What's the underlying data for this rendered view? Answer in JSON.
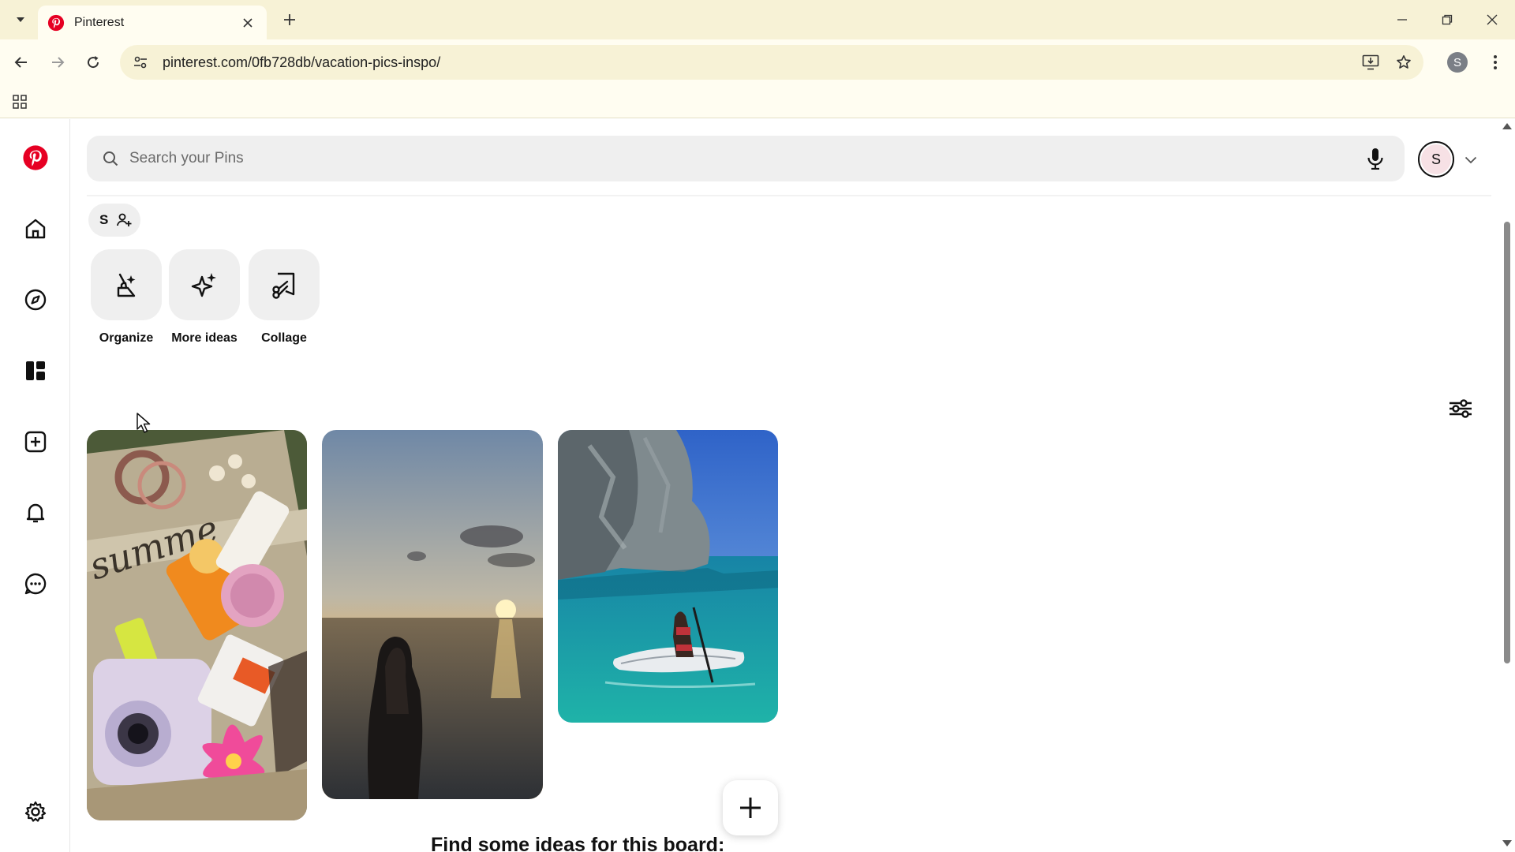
{
  "browser": {
    "tab_title": "Pinterest",
    "url": "pinterest.com/0fb728db/vacation-pics-inspo/",
    "profile_letter": "S"
  },
  "search": {
    "placeholder": "Search your Pins"
  },
  "user": {
    "avatar_letter": "S"
  },
  "board": {
    "collaborator_letter": "S",
    "tools": [
      {
        "label": "Organize",
        "icon": "broom-sparkle-icon"
      },
      {
        "label": "More ideas",
        "icon": "sparkle-icon"
      },
      {
        "label": "Collage",
        "icon": "scissors-collage-icon"
      }
    ],
    "ideas_heading": "Find some ideas for this board:"
  },
  "pins": [
    {
      "description": "flat-lay of beach bag with sunscreen, camera and accessories"
    },
    {
      "description": "woman in sea at sunset"
    },
    {
      "description": "woman on paddle board near sea cliff"
    }
  ],
  "colors": {
    "brand": "#e60023",
    "chrome_tabbar": "#f7f2d6",
    "chrome_toolbar": "#fffdf1",
    "search_bg": "#efefef"
  }
}
